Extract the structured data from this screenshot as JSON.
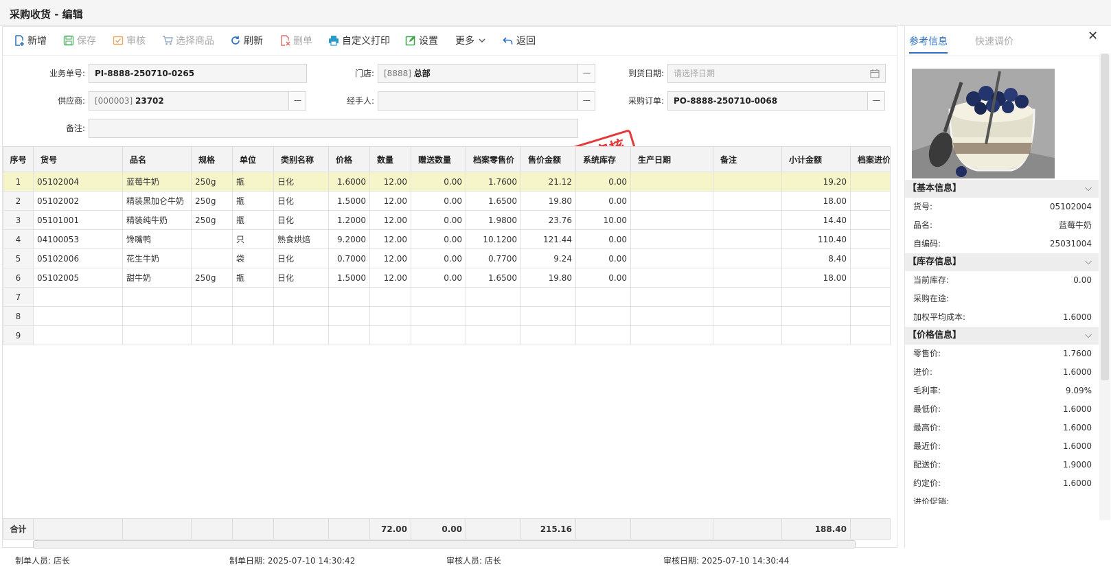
{
  "title": "采购收货 - 编辑",
  "toolbar": {
    "new": "新增",
    "save": "保存",
    "audit": "审核",
    "select_goods": "选择商品",
    "refresh": "刷新",
    "delete": "删单",
    "print": "自定义打印",
    "settings": "设置",
    "more": "更多",
    "back": "返回"
  },
  "form": {
    "bizno_label": "业务单号:",
    "bizno_value": "PI-8888-250710-0265",
    "store_label": "门店:",
    "store_code": "[8888]",
    "store_name": "总部",
    "arrival_label": "到货日期:",
    "arrival_placeholder": "请选择日期",
    "supplier_label": "供应商:",
    "supplier_code": "[000003]",
    "supplier_name": "23702",
    "handler_label": "经手人:",
    "handler_value": "",
    "po_label": "采购订单:",
    "po_value": "PO-8888-250710-0068",
    "remark_label": "备注:",
    "remark_value": "",
    "dots": "---"
  },
  "stamp": "已审核",
  "table": {
    "headers": [
      "序号",
      "货号",
      "品名",
      "规格",
      "单位",
      "类别名称",
      "价格",
      "数量",
      "赠送数量",
      "档案零售价",
      "售价金额",
      "系统库存",
      "生产日期",
      "备注",
      "小计金额",
      "档案进价"
    ],
    "rows": [
      [
        "1",
        "05102004",
        "蓝莓牛奶",
        "250g",
        "瓶",
        "日化",
        "1.6000",
        "12.00",
        "0.00",
        "1.7600",
        "21.12",
        "0.00",
        "",
        "",
        "19.20",
        ""
      ],
      [
        "2",
        "05102002",
        "精装黑加仑牛奶",
        "250g",
        "瓶",
        "日化",
        "1.5000",
        "12.00",
        "0.00",
        "1.6500",
        "19.80",
        "0.00",
        "",
        "",
        "18.00",
        ""
      ],
      [
        "3",
        "05101001",
        "精装纯牛奶",
        "250g",
        "瓶",
        "日化",
        "1.2000",
        "12.00",
        "0.00",
        "1.9800",
        "23.76",
        "10.00",
        "",
        "",
        "14.40",
        ""
      ],
      [
        "4",
        "04100053",
        "馋嘴鸭",
        "",
        "只",
        "熟食烘焙",
        "9.2000",
        "12.00",
        "0.00",
        "10.1200",
        "121.44",
        "0.00",
        "",
        "",
        "110.40",
        ""
      ],
      [
        "5",
        "05102006",
        "花生牛奶",
        "",
        "袋",
        "日化",
        "0.7000",
        "12.00",
        "0.00",
        "0.7700",
        "9.24",
        "0.00",
        "",
        "",
        "8.40",
        ""
      ],
      [
        "6",
        "05102005",
        "甜牛奶",
        "250g",
        "瓶",
        "日化",
        "1.5000",
        "12.00",
        "0.00",
        "1.6500",
        "19.80",
        "0.00",
        "",
        "",
        "18.00",
        ""
      ],
      [
        "7",
        "",
        "",
        "",
        "",
        "",
        "",
        "",
        "",
        "",
        "",
        "",
        "",
        "",
        "",
        ""
      ],
      [
        "8",
        "",
        "",
        "",
        "",
        "",
        "",
        "",
        "",
        "",
        "",
        "",
        "",
        "",
        "",
        ""
      ],
      [
        "9",
        "",
        "",
        "",
        "",
        "",
        "",
        "",
        "",
        "",
        "",
        "",
        "",
        "",
        "",
        ""
      ]
    ],
    "totals": {
      "label": "合计",
      "qty": "72.00",
      "gift": "0.00",
      "sale_amount": "215.16",
      "subtotal": "188.40"
    }
  },
  "footer": {
    "maker_label": "制单人员:",
    "maker": "店长",
    "make_date_label": "制单日期:",
    "make_date": "2025-07-10 14:30:42",
    "auditor_label": "审核人员:",
    "auditor": "店长",
    "audit_date_label": "审核日期:",
    "audit_date": "2025-07-10 14:30:44"
  },
  "right": {
    "tab_ref": "参考信息",
    "tab_quick": "快速调价",
    "basic_title": "【基本信息】",
    "basic": [
      [
        "货号:",
        "05102004"
      ],
      [
        "品名:",
        "蓝莓牛奶"
      ],
      [
        "自编码:",
        "25031004"
      ]
    ],
    "stock_title": "【库存信息】",
    "stock": [
      [
        "当前库存:",
        "0.00"
      ],
      [
        "采购在途:",
        ""
      ],
      [
        "加权平均成本:",
        "1.6000"
      ]
    ],
    "price_title": "【价格信息】",
    "price": [
      [
        "零售价:",
        "1.7600"
      ],
      [
        "进价:",
        "1.6000"
      ],
      [
        "毛利率:",
        "9.09%"
      ],
      [
        "最低价:",
        "1.6000"
      ],
      [
        "最高价:",
        "1.6000"
      ],
      [
        "最近价:",
        "1.6000"
      ],
      [
        "配送价:",
        "1.9000"
      ],
      [
        "约定价:",
        "1.6000"
      ],
      [
        "进价促销:",
        ""
      ]
    ]
  },
  "colors": {
    "accent": "#2b6fc4",
    "stamp": "#e23a3a",
    "selected_row": "#f6f5c9"
  }
}
